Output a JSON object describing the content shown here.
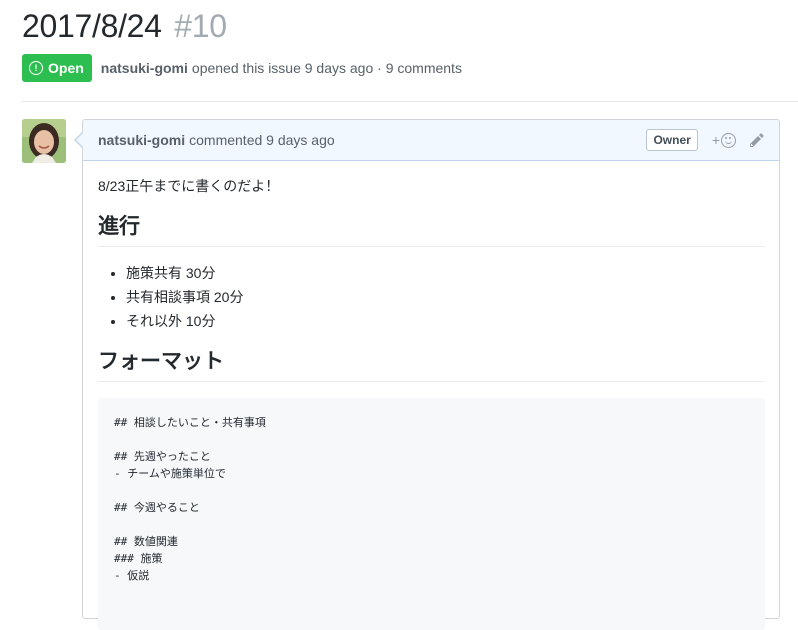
{
  "issue": {
    "title": "2017/8/24",
    "number": "#10",
    "state_label": "Open",
    "author": "natsuki-gomi",
    "meta_text": "opened this issue 9 days ago · 9 comments"
  },
  "comment": {
    "author": "natsuki-gomi",
    "meta_text": "commented 9 days ago",
    "owner_label": "Owner",
    "reaction_plus": "+",
    "body": {
      "intro": "8/23正午までに書くのだよ！",
      "section1_heading": "進行",
      "agenda_items": [
        "施策共有 30分",
        "共有相談事項 20分",
        "それ以外 10分"
      ],
      "section2_heading": "フォーマット",
      "code_lines": [
        "## 相談したいこと・共有事項",
        "",
        "## 先週やったこと",
        "- チームや施策単位で",
        "",
        "## 今週やること",
        "",
        "## 数値関連",
        "### 施策",
        "- 仮説"
      ]
    }
  },
  "icons": {
    "state": "issue-opened-icon",
    "reaction": "smiley-icon",
    "edit": "pencil-icon"
  },
  "colors": {
    "open_green": "#2cbe4e",
    "header_blue_bg": "#f1f8ff",
    "muted_text": "#586069"
  }
}
